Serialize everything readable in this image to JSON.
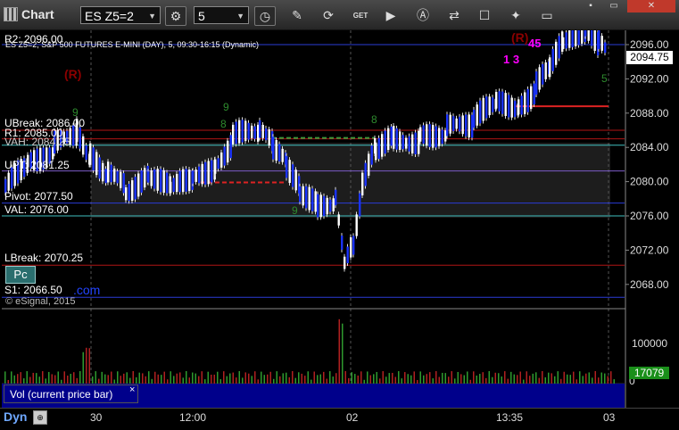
{
  "window": {
    "title": "Chart",
    "symbol": "ES Z5=2",
    "interval": "5",
    "win_controls": [
      "▪",
      "▭",
      "✕"
    ]
  },
  "toolbar": {
    "icons": [
      "settings-icon",
      "clock-icon",
      "pencil-icon",
      "refresh-icon",
      "get-icon",
      "play-icon",
      "alert-icon",
      "link-icon",
      "chat-icon",
      "twitter-icon",
      "window-icon"
    ],
    "get_label": "GET"
  },
  "chart": {
    "header": "ES Z5=2, S&P 500 FUTURES E-MINI (DAY), 5, 09:30-16:15 (Dynamic)",
    "copyright": "© eSignal, 2015",
    "dotcom": ".com",
    "pc_label": "Pc",
    "current_price": "2094.75",
    "y_ticks": [
      "2096.00",
      "2092.00",
      "2088.00",
      "2084.00",
      "2080.00",
      "2076.00",
      "2072.00",
      "2068.00"
    ],
    "x_labels": [
      "30",
      "12:00",
      "02",
      "13:35",
      "03"
    ],
    "levels": [
      {
        "label": "R2: 2096.00",
        "value": 2096.0,
        "color": "#2a3bd6"
      },
      {
        "label": "UBreak: 2086.00",
        "value": 2086.0,
        "color": "#b01515"
      },
      {
        "label": "R1: 2085.00",
        "value": 2085.0,
        "color": "#b01515"
      },
      {
        "label": "VAH: 2084.25",
        "value": 2084.25,
        "color": "#40c0c0"
      },
      {
        "label": "UPT: 2081.25",
        "value": 2081.25,
        "color": "#7b5cc7"
      },
      {
        "label": "Pivot: 2077.50",
        "value": 2077.5,
        "color": "#2a3bd6"
      },
      {
        "label": "VAL: 2076.00",
        "value": 2076.0,
        "color": "#40c0c0"
      },
      {
        "label": "LBreak: 2070.25",
        "value": 2070.25,
        "color": "#b01515"
      },
      {
        "label": "S1: 2066.50",
        "value": 2066.5,
        "color": "#2a3bd6"
      }
    ],
    "annotations": [
      {
        "text": "(R)",
        "color": "#8b0000"
      },
      {
        "text": "(R)",
        "color": "#8b0000"
      },
      {
        "text": "9",
        "color": "#2e8b2e"
      },
      {
        "text": "8",
        "color": "#2e8b2e"
      },
      {
        "text": "9",
        "color": "#2e8b2e"
      },
      {
        "text": "8",
        "color": "#2e8b2e"
      },
      {
        "text": "9",
        "color": "#2e8b2e"
      },
      {
        "text": "1 3",
        "color": "#ff00ff"
      },
      {
        "text": "45",
        "color": "#ff00ff"
      },
      {
        "text": "5",
        "color": "#2e8b2e"
      }
    ]
  },
  "volume": {
    "title": "Vol (current price bar)",
    "close": "×",
    "tick": "100000",
    "zero": "0",
    "current": "17079"
  },
  "footer": {
    "mode": "Dyn"
  }
}
